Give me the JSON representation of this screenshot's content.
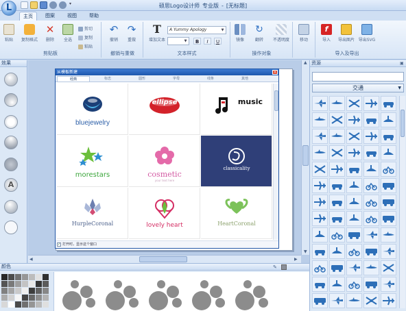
{
  "window": {
    "app_name": "硕思Logo设计师",
    "edition": "专业版",
    "separator": "-",
    "document": "[无标题]"
  },
  "ribbon": {
    "tabs": [
      {
        "label": "主页",
        "active": true
      },
      {
        "label": "图案",
        "active": false
      },
      {
        "label": "视图",
        "active": false
      },
      {
        "label": "帮助",
        "active": false
      }
    ],
    "groups": {
      "clipboard": {
        "label": "剪贴板",
        "paste": "粘贴",
        "copy_format": "复制格式",
        "delete": "删除",
        "select_all": "全选",
        "cut": "剪切",
        "copy": "复制",
        "paste_small": "粘贴"
      },
      "undo_redo": {
        "label": "撤销与重做",
        "undo": "撤销",
        "redo": "重做"
      },
      "text_style": {
        "label": "文本样式",
        "add_text": "增加文本",
        "font": "A Yummy Apology",
        "bold": "B",
        "italic": "I",
        "underline": "U"
      },
      "operate": {
        "label": "操作对象",
        "flip": "镜像",
        "rotate": "翻转",
        "opacity": "不透明度"
      },
      "misc": {
        "move": "移动"
      },
      "import_export": {
        "label": "导入及导出",
        "import": "导入",
        "export_image": "导出图片",
        "export_svg": "导出SVG"
      }
    }
  },
  "left_panel": {
    "title": "效果"
  },
  "dialog": {
    "title": "从模板新建",
    "close": "×",
    "tabs": [
      "经典",
      "标志",
      "圆形",
      "字母",
      "线条",
      "其他"
    ],
    "templates": [
      {
        "name": "bluejewelry",
        "color": "#2c5fa8"
      },
      {
        "name": "ellipse",
        "color": "#ffffff"
      },
      {
        "name": "music",
        "color": "#111111"
      },
      {
        "name": "morestars",
        "color": "#3aa53a"
      },
      {
        "name": "cosmetic",
        "sub": "your text here",
        "color": "#d35aa3"
      },
      {
        "name": "classicality",
        "color": "#ffffff"
      },
      {
        "name": "HurpleCoronal",
        "color": "#4a5f8a"
      },
      {
        "name": "lovely heart",
        "color": "#d42d63"
      },
      {
        "name": "HeartCoronal",
        "color": "#8aa06b"
      }
    ],
    "footer_text": "打开时，显示这个窗口",
    "footer_checked": true
  },
  "right_panel": {
    "title": "资源",
    "search_placeholder": "",
    "category": "交通"
  },
  "bottom_panel": {
    "title": "颜色"
  },
  "colors": {
    "accent": "#1d57ad",
    "panel_bg": "#dce8f6",
    "selected_template_bg": "#2f3f78",
    "icon_blue": "#2d6fb8"
  }
}
